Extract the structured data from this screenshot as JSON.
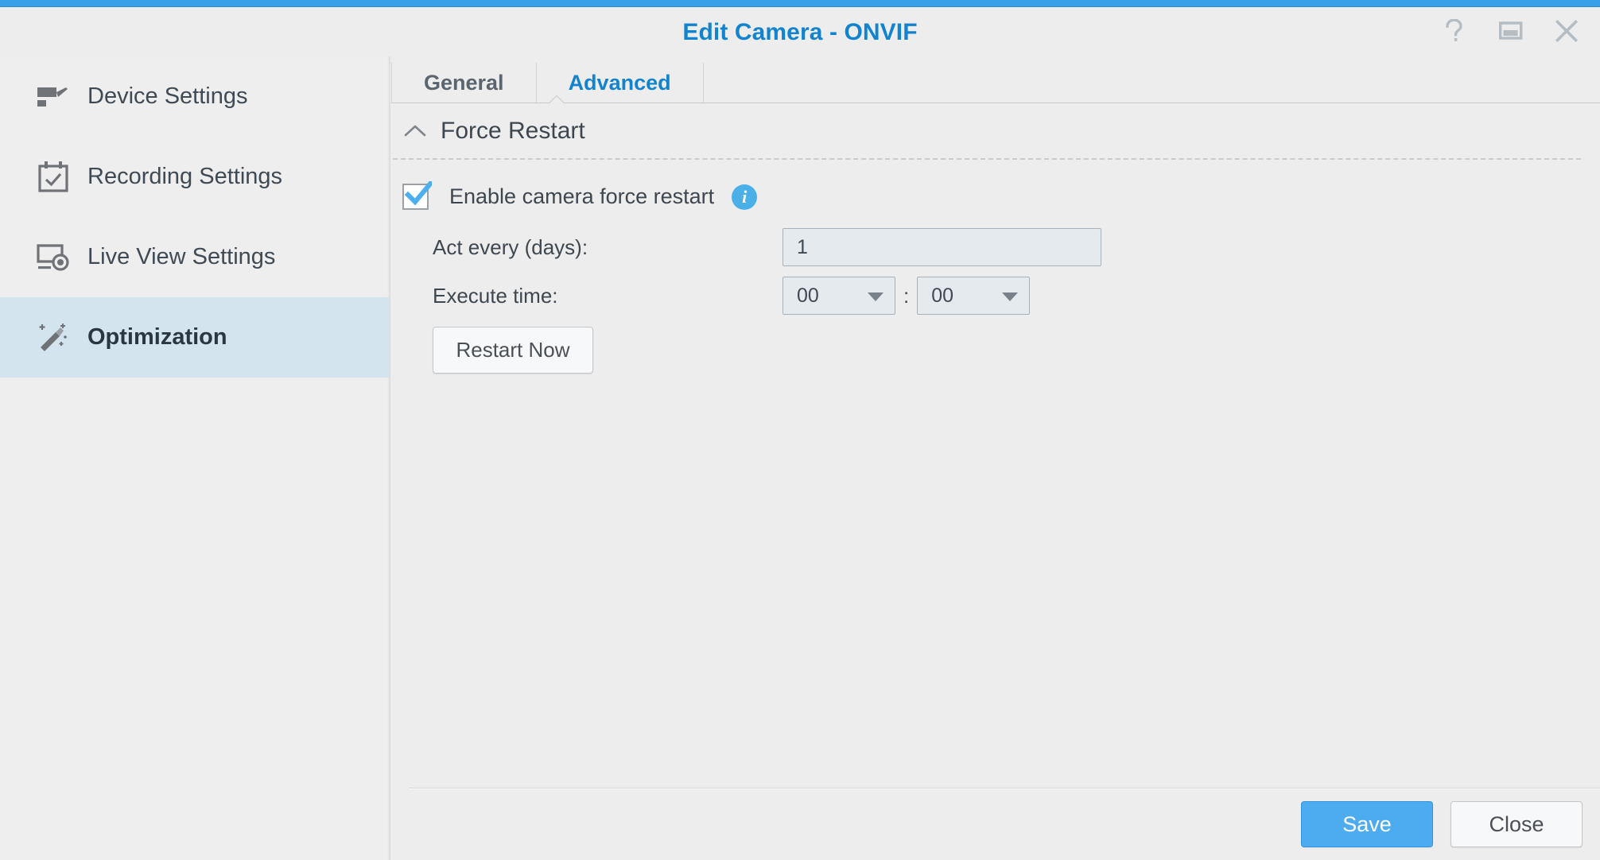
{
  "window": {
    "title": "Edit Camera - ONVIF",
    "accent_color": "#38a0e8",
    "title_color": "#1283ce",
    "controls": [
      {
        "name": "help-icon",
        "label": "?"
      },
      {
        "name": "restore-icon",
        "label": "Restore"
      },
      {
        "name": "close-icon",
        "label": "X"
      }
    ]
  },
  "sidebar": {
    "items": [
      {
        "label": "Device Settings",
        "icon": "camera-icon",
        "active": false
      },
      {
        "label": "Recording Settings",
        "icon": "calendar-check-icon",
        "active": false
      },
      {
        "label": "Live View Settings",
        "icon": "monitor-record-icon",
        "active": false
      },
      {
        "label": "Optimization",
        "icon": "magic-wand-icon",
        "active": true
      }
    ],
    "active_background": "#d3e4ef"
  },
  "tabs": [
    {
      "label": "General",
      "active": false
    },
    {
      "label": "Advanced",
      "active": true
    }
  ],
  "section": {
    "title": "Force Restart",
    "collapse_icon": "chevron-up-icon"
  },
  "form": {
    "enable_checkbox": {
      "label": "Enable camera force restart",
      "checked": true,
      "info_icon": "info-icon",
      "info_glyph": "i"
    },
    "act_every": {
      "label": "Act every (days):",
      "value": "1"
    },
    "execute_time": {
      "label": "Execute time:",
      "hour": "00",
      "minute": "00",
      "separator": ":"
    },
    "restart_now_label": "Restart Now"
  },
  "footer": {
    "save_label": "Save",
    "close_label": "Close",
    "save_color": "#4cacef"
  }
}
